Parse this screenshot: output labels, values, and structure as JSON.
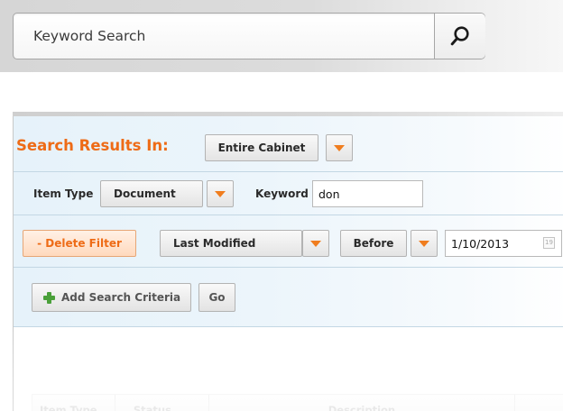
{
  "search": {
    "placeholder": "Keyword Search",
    "button_icon": "search-icon"
  },
  "panel": {
    "title": "Search Results In:",
    "scope": {
      "selected": "Entire Cabinet"
    },
    "item_type": {
      "label": "Item Type",
      "selected": "Document"
    },
    "keyword": {
      "label": "Keyword",
      "value": "don"
    },
    "filter": {
      "delete_label": "- Delete Filter",
      "field_selected": "Last Modified",
      "operator_selected": "Before",
      "date_value": "1/10/2013",
      "calendar_icon": "calendar-icon",
      "calendar_icon_text": "19"
    },
    "add_criteria_label": "Add Search Criteria",
    "go_label": "Go"
  },
  "table": {
    "columns": [
      "Item Type",
      "Status",
      "Description"
    ]
  },
  "colors": {
    "accent": "#ee6b16",
    "panel_bg": "#e6f2fa",
    "plus_icon": "#4aa03a"
  }
}
